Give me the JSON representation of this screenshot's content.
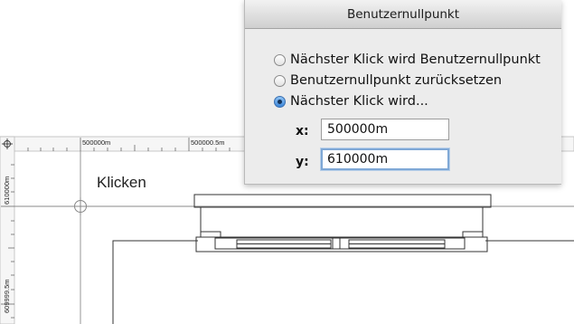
{
  "dialog": {
    "title": "Benutzernullpunkt",
    "options": [
      {
        "label": "Nächster Klick wird Benutzernullpunkt",
        "checked": false
      },
      {
        "label": "Benutzernullpunkt zurücksetzen",
        "checked": false
      },
      {
        "label": "Nächster Klick wird...",
        "checked": true
      }
    ],
    "x_label": "x:",
    "x_value": "500000m",
    "y_label": "y:",
    "y_value": "610000m"
  },
  "canvas": {
    "annotation": "Klicken",
    "ruler_top": [
      "500000m",
      "500000.5m"
    ],
    "ruler_left": [
      "610000m",
      "609999.5m"
    ]
  }
}
